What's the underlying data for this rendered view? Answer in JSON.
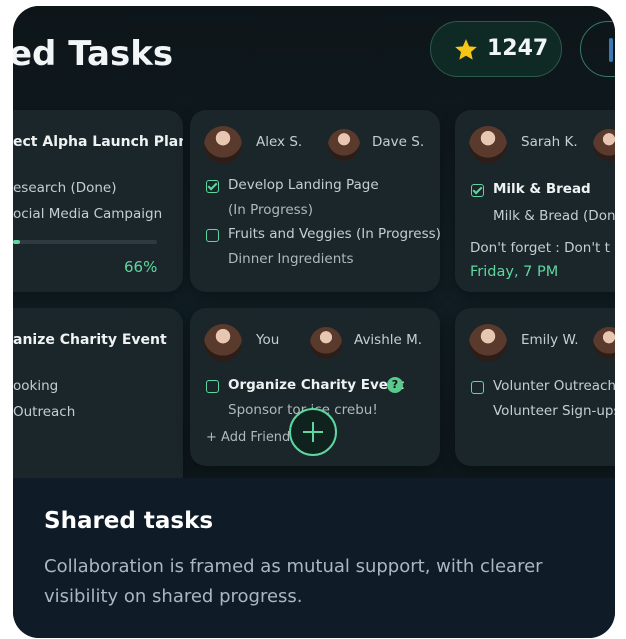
{
  "header": {
    "title": "ed Tasks",
    "points": "1247"
  },
  "tiles": {
    "alpha": {
      "title": "ect Alpha Launch Plan",
      "items": [
        "esearch (Done)",
        "ocial Media Campaign"
      ],
      "progress_pct": 66,
      "progress_label": "66%"
    },
    "alex_dave": {
      "member_a": "Alex S.",
      "member_b": "Dave S.",
      "items": [
        {
          "text": "Develop Landing Page",
          "sub": "(In Progress)",
          "checked": true
        },
        {
          "text": "Fruits and Veggies (In Progress)",
          "sub": "Dinner Ingredients",
          "checked": false
        }
      ]
    },
    "sarah": {
      "member_a": "Sarah K.",
      "item": "Milk & Bread",
      "item_sub": "Milk & Bread (Done",
      "note": "Don't forget : Don't t ic",
      "note_time": "Friday, 7 PM"
    },
    "charity_left": {
      "title": "anize Charity Event",
      "items": [
        "ooking",
        "Outreach"
      ]
    },
    "you_avishle": {
      "member_a": "You",
      "member_b": "Avishle M.",
      "item": "Organize Charity Event",
      "item_badge": "?",
      "item_sub": "Sponsor tor ice crebu!",
      "add_friend": "+ Add Friend"
    },
    "emily": {
      "member_a": "Emily W.",
      "items": [
        "Volunter Outreach",
        "Volunteer Sign-ups"
      ]
    }
  },
  "caption": {
    "title": "Shared tasks",
    "description": "Collaboration is framed as mutual support, with clearer visibility on shared progress."
  },
  "colors": {
    "accent": "#5fd6a0",
    "star": "#f5c518",
    "caption_bg": "#0f1c28"
  },
  "icons": [
    "star-icon",
    "checkbox-icon",
    "plus-icon",
    "help-icon"
  ]
}
